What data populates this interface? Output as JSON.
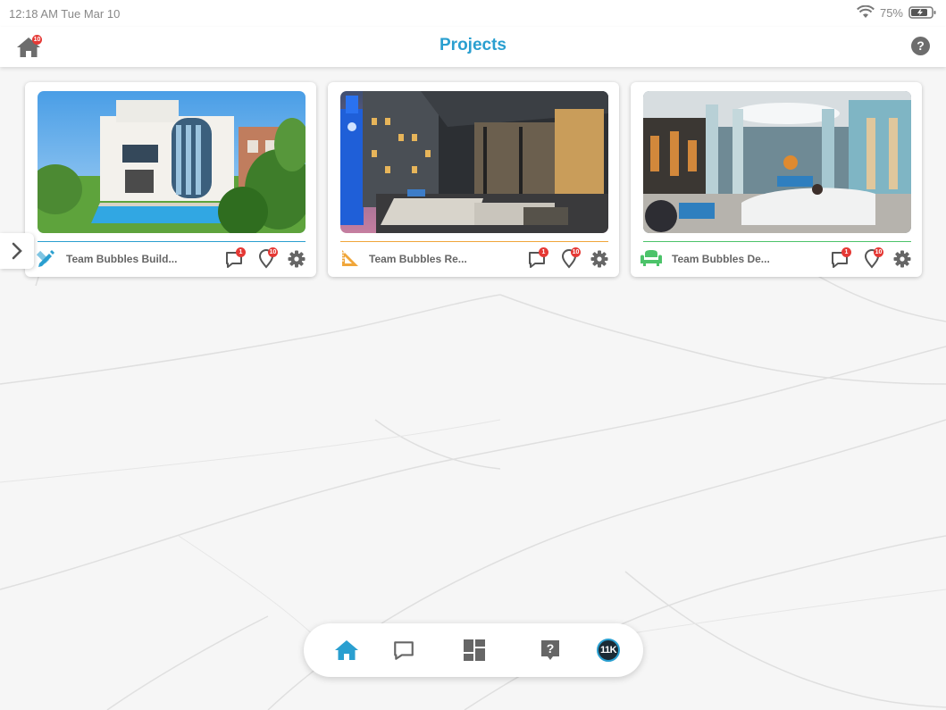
{
  "status_bar": {
    "time": "12:18 AM  Tue Mar 10",
    "battery": "75%",
    "icons": [
      "wifi-icon",
      "battery-charging-icon"
    ]
  },
  "header": {
    "title": "Projects",
    "home_badge": "10",
    "accent_color": "#2a9fd0"
  },
  "projects": [
    {
      "name": "Team Bubbles Build...",
      "category_icon": "design-tools-icon",
      "category_color": "#2a9fd0",
      "image": "modern-villa-with-pool",
      "chat_badge": "1",
      "pin_badge": "10"
    },
    {
      "name": "Team Bubbles Re...",
      "category_icon": "ruler-icon",
      "category_color": "#f0a63a",
      "image": "rooftop-terrace-night",
      "chat_badge": "1",
      "pin_badge": "10"
    },
    {
      "name": "Team Bubbles De...",
      "category_icon": "armchair-icon",
      "category_color": "#4cc36a",
      "image": "hotel-lobby-interior",
      "chat_badge": "1",
      "pin_badge": "10"
    }
  ],
  "dock": {
    "items": [
      "home-icon",
      "chat-icon",
      "dashboard-icon",
      "help-icon",
      "profile-avatar"
    ],
    "avatar_text": "11K",
    "active_item": "home-icon"
  }
}
